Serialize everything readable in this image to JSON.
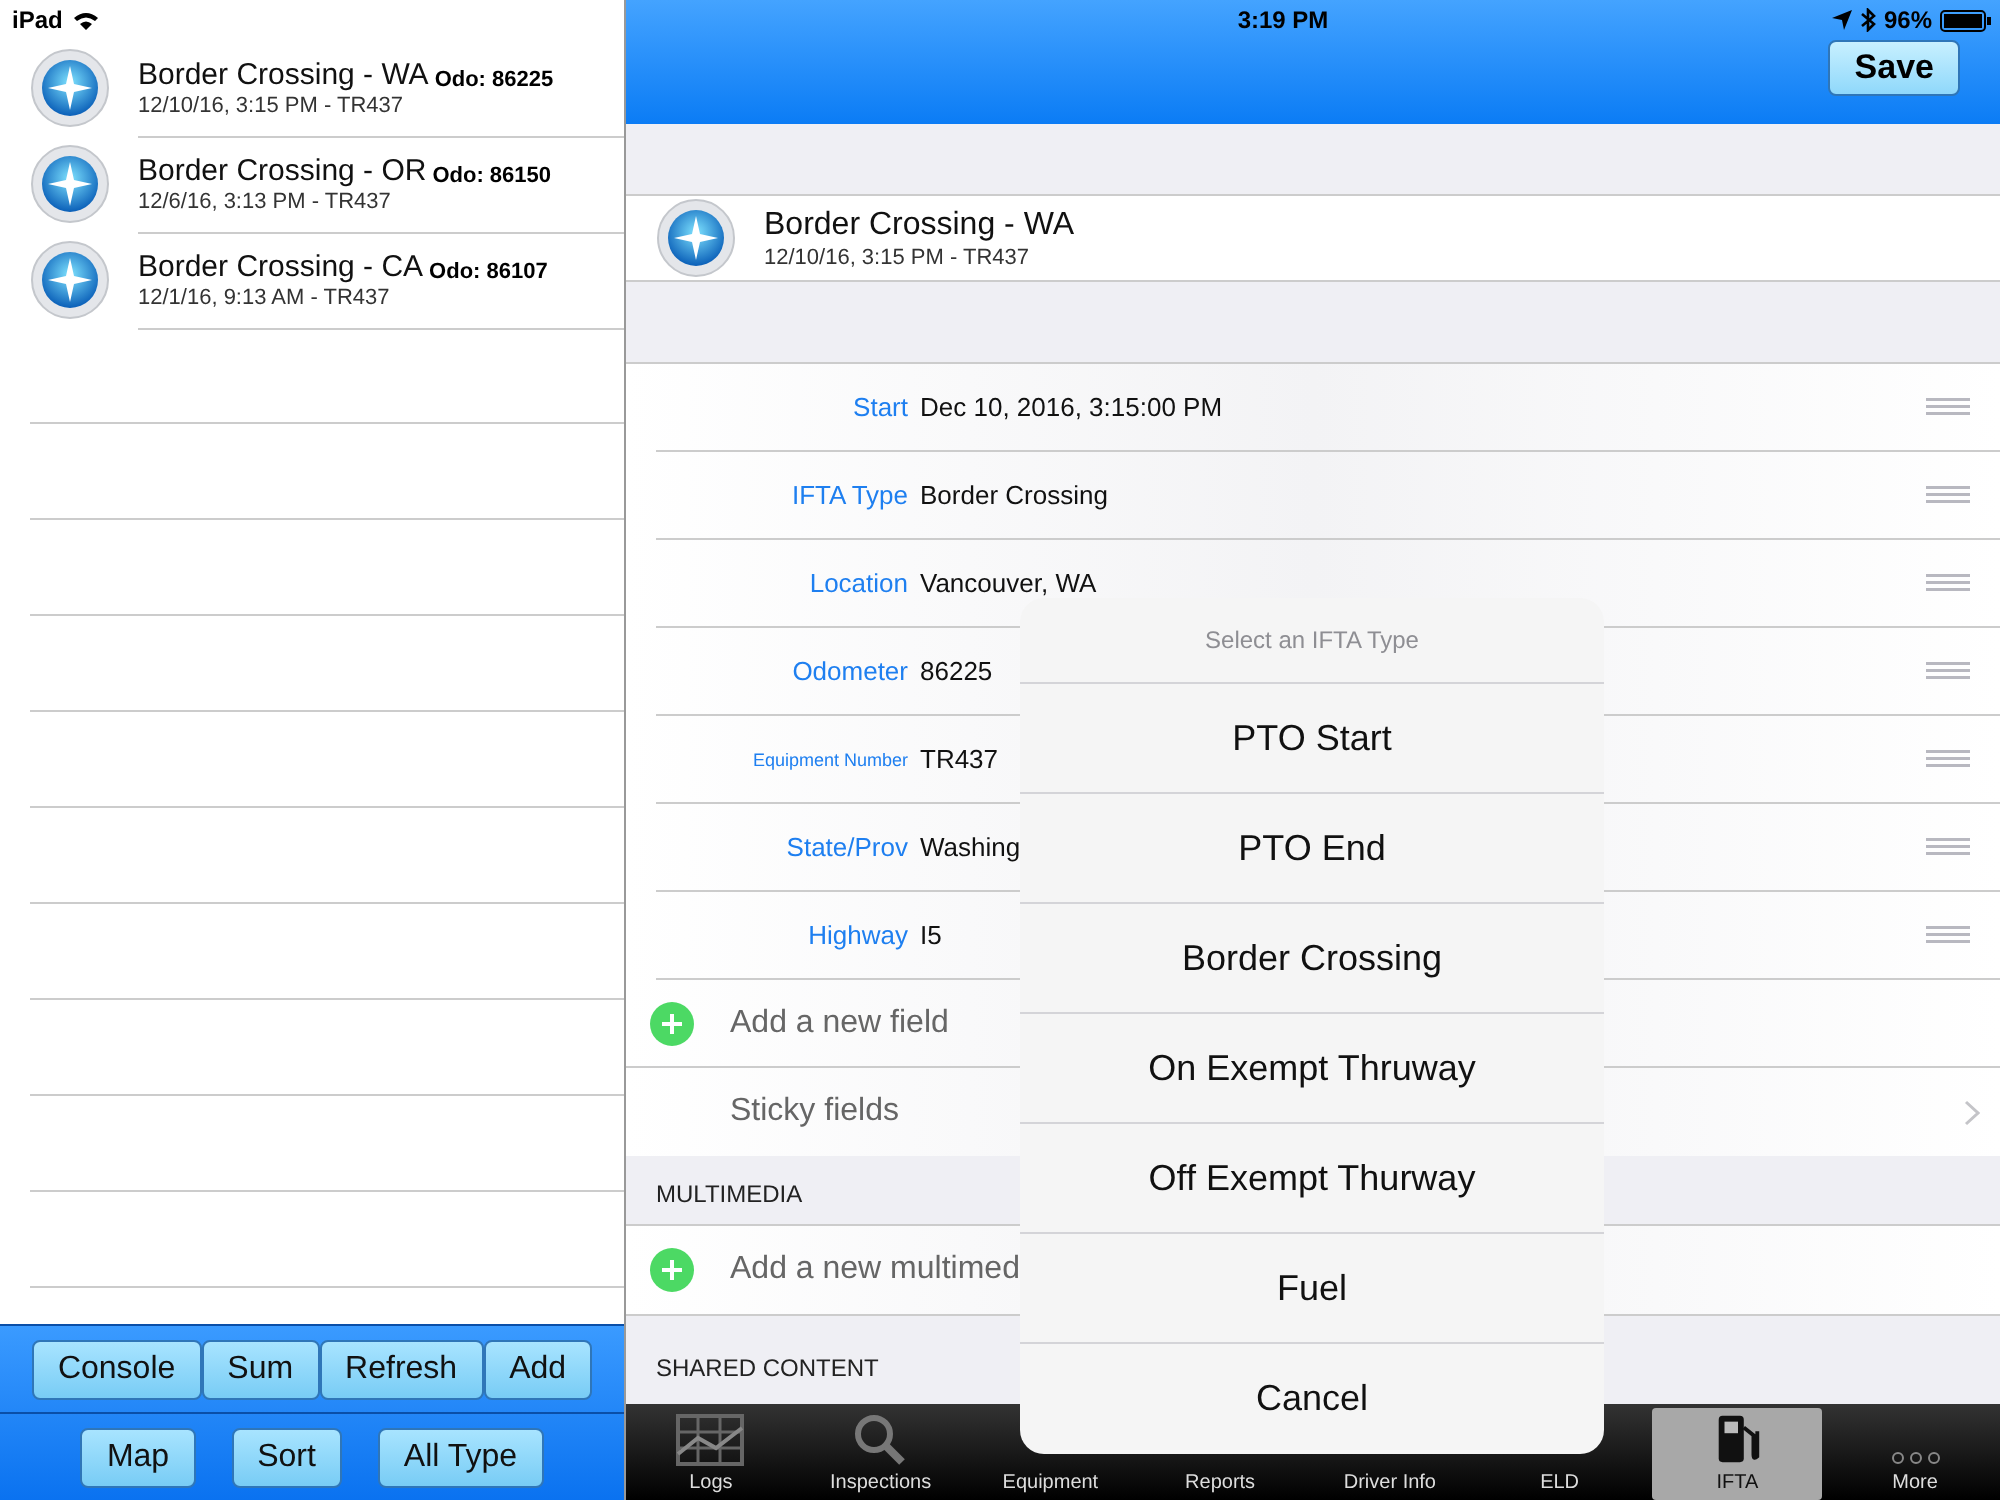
{
  "status_bar": {
    "device": "iPad",
    "time": "3:19 PM",
    "battery": "96%"
  },
  "records": [
    {
      "title": "Border Crossing - WA",
      "subtitle": "12/10/16, 3:15 PM - TR437",
      "odo": "Odo: 86225"
    },
    {
      "title": "Border Crossing - OR",
      "subtitle": "12/6/16, 3:13 PM - TR437",
      "odo": "Odo: 86150"
    },
    {
      "title": "Border Crossing - CA",
      "subtitle": "12/1/16, 9:13 AM - TR437",
      "odo": "Odo: 86107"
    }
  ],
  "left_toolbar": {
    "row_1": [
      "Console",
      "Sum",
      "Refresh",
      "Add"
    ],
    "row_2": [
      "Map",
      "Sort",
      "All Type"
    ]
  },
  "nav": {
    "save": "Save"
  },
  "selected_record": {
    "title": "Border Crossing - WA",
    "subtitle": "12/10/16, 3:15 PM - TR437"
  },
  "fields": [
    {
      "label": "Start",
      "value": "Dec 10, 2016, 3:15:00 PM"
    },
    {
      "label": "IFTA Type",
      "value": "Border Crossing"
    },
    {
      "label": "Location",
      "value": "Vancouver, WA"
    },
    {
      "label": "Odometer",
      "value": "86225"
    },
    {
      "label": "Equipment Number",
      "value": "TR437"
    },
    {
      "label": "State/Prov",
      "value": "Washing"
    },
    {
      "label": "Highway",
      "value": "I5"
    }
  ],
  "add_field": "Add a new field",
  "sticky_fields": "Sticky fields",
  "multimedia": {
    "header": "MULTIMEDIA",
    "add": "Add a new multimed"
  },
  "shared_header": "SHARED CONTENT",
  "picker": {
    "title": "Select an IFTA Type",
    "options": [
      "PTO Start",
      "PTO End",
      "Border Crossing",
      "On Exempt Thruway",
      "Off Exempt Thurway",
      "Fuel"
    ],
    "cancel": "Cancel"
  },
  "tabs": [
    {
      "label": "Logs",
      "kind": "chart",
      "selected": false
    },
    {
      "label": "Inspections",
      "kind": "search",
      "selected": false
    },
    {
      "label": "Equipment",
      "kind": "plain",
      "selected": false
    },
    {
      "label": "Reports",
      "kind": "plain",
      "selected": false
    },
    {
      "label": "Driver Info",
      "kind": "plain",
      "selected": false
    },
    {
      "label": "ELD",
      "kind": "plain",
      "selected": false
    },
    {
      "label": "IFTA",
      "kind": "pump",
      "selected": true
    },
    {
      "label": "More",
      "kind": "dots",
      "selected": false
    }
  ]
}
